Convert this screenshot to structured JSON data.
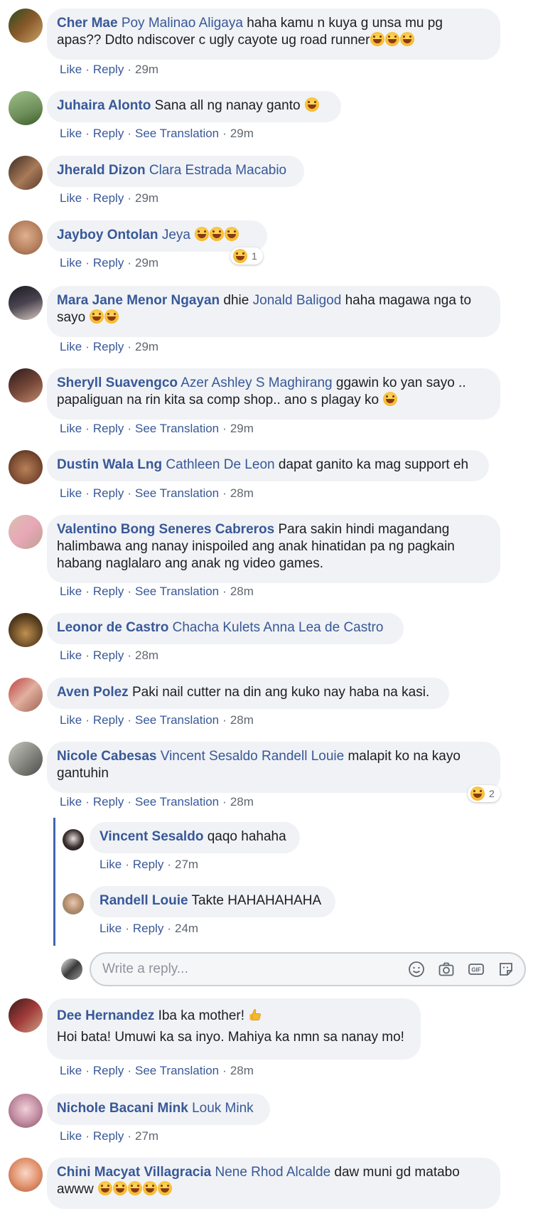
{
  "actions": {
    "like": "Like",
    "reply": "Reply",
    "see_translation": "See Translation",
    "dot": "·"
  },
  "comments": [
    {
      "author": "Cher Mae",
      "tags": "Poy Malinao Aligaya",
      "text_1": "haha kamu n kuya g unsa mu pg",
      "text_2": "apas?? Ddto ndiscover c ugly cayote ug road runner",
      "time": "29m"
    },
    {
      "author": "Juhaira Alonto",
      "text": "Sana all ng nanay ganto",
      "time": "29m"
    },
    {
      "author": "Jherald Dizon",
      "tags": "Clara Estrada Macabio",
      "time": "29m"
    },
    {
      "author": "Jayboy Ontolan",
      "tags": "Jeya",
      "time": "29m",
      "reaction_count": "1"
    },
    {
      "author": "Mara Jane Menor Ngayan",
      "text_pre": "dhie",
      "tags": "Jonald Baligod",
      "text_1": "haha magawa nga to",
      "text_2": "sayo",
      "time": "29m"
    },
    {
      "author": "Sheryll Suavengco",
      "tags": "Azer Ashley S Maghirang",
      "text_1": "ggawin ko yan sayo ..",
      "text_2": "papaliguan na rin kita sa comp shop.. ano s plagay ko",
      "time": "29m"
    },
    {
      "author": "Dustin Wala Lng",
      "tags": "Cathleen De Leon",
      "text": "dapat ganito ka mag support eh",
      "time": "28m"
    },
    {
      "author": "Valentino Bong Seneres Cabreros",
      "text_1": "Para sakin hindi magandang",
      "text_2": "halimbawa ang nanay inispoiled ang anak hinatidan pa ng pagkain",
      "text_3": "habang naglalaro ang anak ng video games.",
      "time": "28m"
    },
    {
      "author": "Leonor de Castro",
      "tags": "Chacha Kulets Anna Lea de Castro",
      "time": "28m"
    },
    {
      "author": "Aven Polez",
      "text": "Paki nail cutter na din ang kuko nay haba na kasi.",
      "time": "28m"
    },
    {
      "author": "Nicole Cabesas",
      "tags": "Vincent Sesaldo Randell Louie",
      "text_1": "malapit ko na kayo",
      "text_2": "gantuhin",
      "time": "28m",
      "reaction_count": "2"
    },
    {
      "author": "Dee Hernandez",
      "text_1": "Iba ka mother!",
      "text_2": "Hoi bata! Umuwi ka sa inyo. Mahiya ka nmn sa nanay mo!",
      "time": "28m"
    },
    {
      "author": "Nichole Bacani Mink",
      "tags": "Louk Mink",
      "time": "27m"
    },
    {
      "author": "Chini Macyat Villagracia",
      "tags": "Nene Rhod Alcalde",
      "text_1": "daw muni gd matabo",
      "text_2": "awww"
    }
  ],
  "replies": [
    {
      "author": "Vincent Sesaldo",
      "text": "qaqo hahaha",
      "time": "27m"
    },
    {
      "author": "Randell Louie",
      "text": "Takte HAHAHAHAHA",
      "time": "24m"
    }
  ],
  "reply_box": {
    "placeholder": "Write a reply..."
  },
  "colors": {
    "link": "#385898",
    "bubble": "#f0f2f5",
    "meta": "#606770",
    "thread": "#4267b2"
  }
}
